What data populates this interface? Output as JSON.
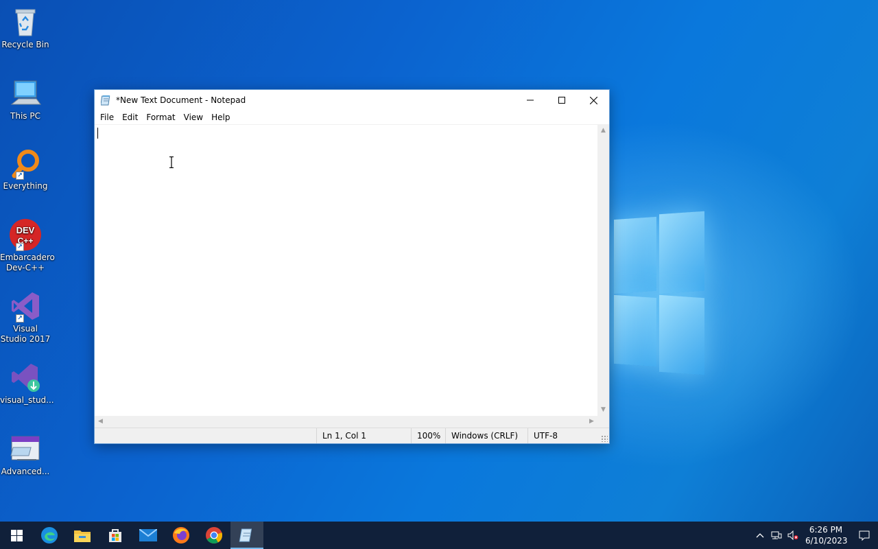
{
  "desktop": {
    "icons": [
      {
        "label": "Recycle Bin"
      },
      {
        "label": "This PC"
      },
      {
        "label": "Everything"
      },
      {
        "label": "Embarcadero Dev-C++",
        "badge": "DEV C++"
      },
      {
        "label": "Visual Studio 2017"
      },
      {
        "label": "visual_stud..."
      },
      {
        "label": "Advanced..."
      }
    ]
  },
  "notepad": {
    "title": "*New Text Document - Notepad",
    "menu": [
      "File",
      "Edit",
      "Format",
      "View",
      "Help"
    ],
    "content": "",
    "status": {
      "position": "Ln 1, Col 1",
      "zoom": "100%",
      "line_ending": "Windows (CRLF)",
      "encoding": "UTF-8"
    }
  },
  "taskbar": {
    "apps": [
      "start",
      "edge",
      "file-explorer",
      "microsoft-store",
      "mail",
      "firefox",
      "chrome",
      "notepad"
    ],
    "active_app": "notepad",
    "clock": {
      "time": "6:26 PM",
      "date": "6/10/2023"
    }
  },
  "colors": {
    "taskbar": "#10203a",
    "accent": "#76b9ed",
    "desktop": "#0b63cf"
  }
}
